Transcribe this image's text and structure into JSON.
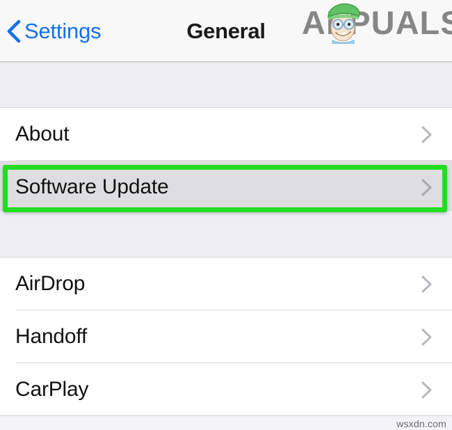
{
  "navbar": {
    "back_label": "Settings",
    "back_icon": "chevron-left-icon",
    "title": "General",
    "back_color": "#1570e8",
    "title_color": "#1a1a1a"
  },
  "watermark": {
    "brand": "APPUALS",
    "brand_color": "#7d7d7d",
    "mascot_hat_color": "#5fc264",
    "footer": "wsxdn.com"
  },
  "highlight": {
    "color": "#22dd22",
    "target": "Software Update"
  },
  "sections": [
    {
      "name": "section-one",
      "rows": [
        {
          "label": "About",
          "chevron": "chevron-right-icon",
          "pressed": false,
          "separator": true
        },
        {
          "label": "Software Update",
          "chevron": "chevron-right-icon",
          "pressed": true,
          "separator": false
        }
      ]
    },
    {
      "name": "section-two",
      "rows": [
        {
          "label": "AirDrop",
          "chevron": "chevron-right-icon",
          "pressed": false,
          "separator": true
        },
        {
          "label": "Handoff",
          "chevron": "chevron-right-icon",
          "pressed": false,
          "separator": true
        },
        {
          "label": "CarPlay",
          "chevron": "chevron-right-icon",
          "pressed": false,
          "separator": false
        }
      ]
    }
  ]
}
